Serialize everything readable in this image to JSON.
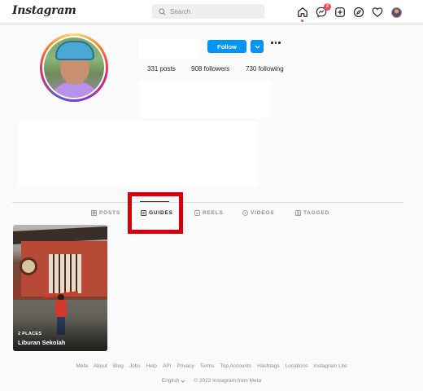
{
  "nav": {
    "logo": "Instagram",
    "search_placeholder": "Search",
    "notification_badge": "2",
    "icons": [
      "home-icon",
      "messenger-icon",
      "new-post-icon",
      "explore-icon",
      "heart-icon",
      "profile-avatar"
    ]
  },
  "profile": {
    "follow_label": "Follow",
    "stats": {
      "posts": "331 posts",
      "followers": "908 followers",
      "following": "730 following"
    }
  },
  "tabs": [
    {
      "label": "POSTS",
      "icon": "grid-icon",
      "active": false
    },
    {
      "label": "GUIDES",
      "icon": "guides-icon",
      "active": true
    },
    {
      "label": "REELS",
      "icon": "reels-icon",
      "active": false
    },
    {
      "label": "VIDEOS",
      "icon": "video-icon",
      "active": false
    },
    {
      "label": "TAGGED",
      "icon": "tagged-icon",
      "active": false
    }
  ],
  "guide": {
    "subtitle": "2 PLACES",
    "title": "Liburan Sekolah"
  },
  "footer": {
    "links": [
      "Meta",
      "About",
      "Blog",
      "Jobs",
      "Help",
      "API",
      "Privacy",
      "Terms",
      "Top Accounts",
      "Hashtags",
      "Locations",
      "Instagram Lite"
    ],
    "language": "English",
    "copyright": "© 2022 Instagram from Meta"
  },
  "colors": {
    "accent": "#0095f6",
    "highlight": "#d6000c",
    "badge": "#ed4956"
  }
}
